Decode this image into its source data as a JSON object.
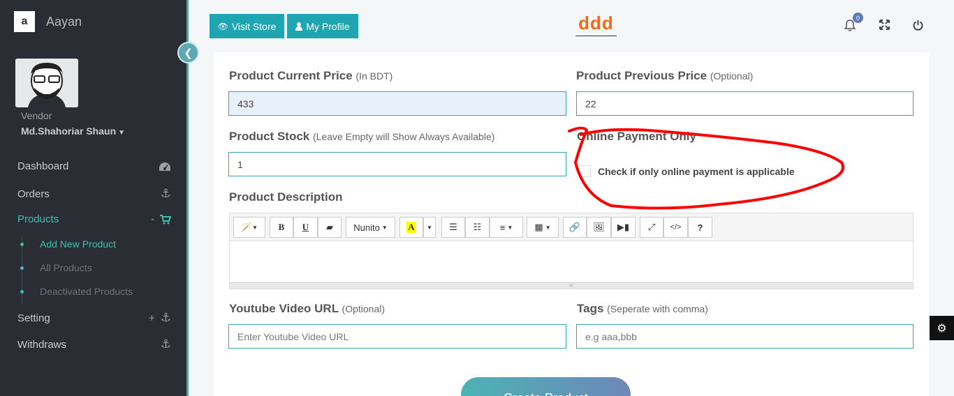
{
  "sidebar": {
    "brand_name": "Aayan",
    "brand_logo_letter": "a",
    "role": "Vendor",
    "user_name": "Md.Shahoriar Shaun",
    "nav": {
      "dashboard": "Dashboard",
      "orders": "Orders",
      "products": "Products",
      "products_toggle": "-",
      "setting": "Setting",
      "setting_toggle": "+",
      "withdraws": "Withdraws"
    },
    "products_sub": [
      "Add New Product",
      "All Products",
      "Deactivated Products"
    ]
  },
  "header": {
    "visit_store": "Visit Store",
    "my_profile": "My Profile",
    "logo_text": "ddd",
    "notification_count": "0"
  },
  "form": {
    "current_price": {
      "label": "Product Current Price",
      "hint": "(In BDT)",
      "value": "433"
    },
    "previous_price": {
      "label": "Product Previous Price",
      "hint": "(Optional)",
      "value": "22"
    },
    "stock": {
      "label": "Product Stock",
      "hint": "(Leave Empty will Show Always Available)",
      "value": "1"
    },
    "online_payment": {
      "label": "Online Payment Only",
      "checkbox_label": "Check if only online payment is applicable",
      "checked": false
    },
    "description": {
      "label": "Product Description",
      "font_select": "Nunito"
    },
    "youtube": {
      "label": "Youtube Video URL",
      "hint": "(Optional)",
      "placeholder": "Enter Youtube Video URL"
    },
    "tags": {
      "label": "Tags",
      "hint": "(Seperate with comma)",
      "placeholder": "e.g aaa,bbb"
    },
    "submit": "Create Product"
  },
  "colors": {
    "accent": "#1fa5b2",
    "sidebar_bg": "#2a2d33",
    "active": "#3cc0b1",
    "annotation": "#ff0000"
  }
}
